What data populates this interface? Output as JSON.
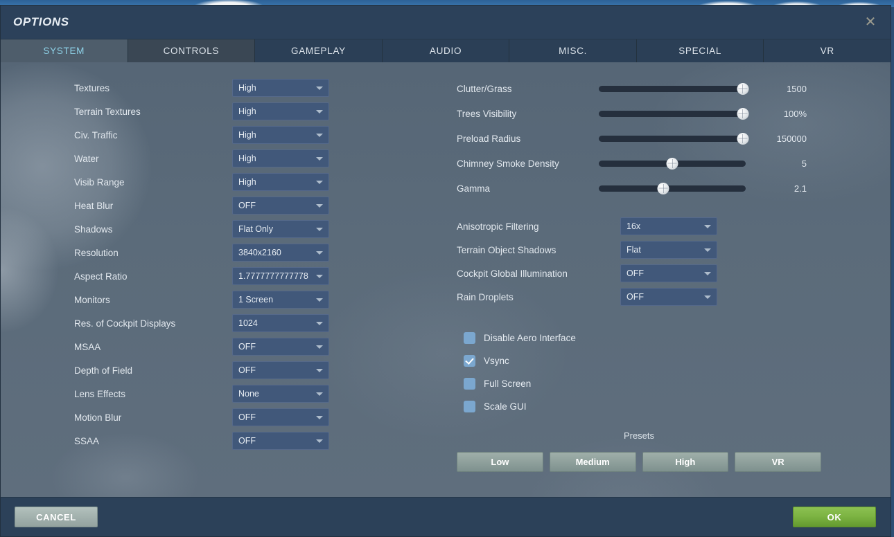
{
  "window": {
    "title": "OPTIONS",
    "close_icon": "close-icon"
  },
  "tabs": [
    {
      "label": "SYSTEM",
      "active": true
    },
    {
      "label": "CONTROLS",
      "active": false
    },
    {
      "label": "GAMEPLAY",
      "active": false
    },
    {
      "label": "AUDIO",
      "active": false
    },
    {
      "label": "MISC.",
      "active": false
    },
    {
      "label": "SPECIAL",
      "active": false
    },
    {
      "label": "VR",
      "active": false
    }
  ],
  "left_column": [
    {
      "label": "Textures",
      "value": "High"
    },
    {
      "label": "Terrain Textures",
      "value": "High"
    },
    {
      "label": "Civ. Traffic",
      "value": "High"
    },
    {
      "label": "Water",
      "value": "High"
    },
    {
      "label": "Visib Range",
      "value": "High"
    },
    {
      "label": "Heat Blur",
      "value": "OFF"
    },
    {
      "label": "Shadows",
      "value": "Flat Only"
    },
    {
      "label": "Resolution",
      "value": "3840x2160"
    },
    {
      "label": "Aspect Ratio",
      "value": "1.7777777777778"
    },
    {
      "label": "Monitors",
      "value": "1 Screen"
    },
    {
      "label": "Res. of Cockpit Displays",
      "value": "1024"
    },
    {
      "label": "MSAA",
      "value": "OFF"
    },
    {
      "label": "Depth of Field",
      "value": "OFF"
    },
    {
      "label": "Lens Effects",
      "value": "None"
    },
    {
      "label": "Motion Blur",
      "value": "OFF"
    },
    {
      "label": "SSAA",
      "value": "OFF"
    }
  ],
  "sliders": [
    {
      "label": "Clutter/Grass",
      "value": "1500",
      "percent": 98
    },
    {
      "label": "Trees Visibility",
      "value": "100%",
      "percent": 98
    },
    {
      "label": "Preload Radius",
      "value": "150000",
      "percent": 98
    },
    {
      "label": "Chimney Smoke Density",
      "value": "5",
      "percent": 50
    },
    {
      "label": "Gamma",
      "value": "2.1",
      "percent": 44
    }
  ],
  "right_dropdowns": [
    {
      "label": "Anisotropic Filtering",
      "value": "16x"
    },
    {
      "label": "Terrain Object Shadows",
      "value": "Flat"
    },
    {
      "label": "Cockpit Global Illumination",
      "value": "OFF"
    },
    {
      "label": "Rain Droplets",
      "value": "OFF"
    }
  ],
  "checkboxes": [
    {
      "label": "Disable Aero Interface",
      "checked": false
    },
    {
      "label": "Vsync",
      "checked": true
    },
    {
      "label": "Full Screen",
      "checked": false
    },
    {
      "label": "Scale GUI",
      "checked": false
    }
  ],
  "presets": {
    "title": "Presets",
    "buttons": [
      {
        "label": "Low"
      },
      {
        "label": "Medium"
      },
      {
        "label": "High"
      },
      {
        "label": "VR"
      }
    ]
  },
  "footer": {
    "cancel_label": "CANCEL",
    "ok_label": "OK"
  },
  "colors": {
    "dialog_bg": "#2e4156",
    "title_bar": "#2c415a",
    "content_bg": "#5b6b7a",
    "tab_active_bg": "#4e5d6b",
    "tab_active_text": "#8ed2e8",
    "dropdown_bg": "#41587a",
    "checkbox": "#7ba7cf",
    "ok_green": "#7cb342",
    "cancel_gray": "#a3b2ae",
    "slider_track": "#252f3d"
  }
}
